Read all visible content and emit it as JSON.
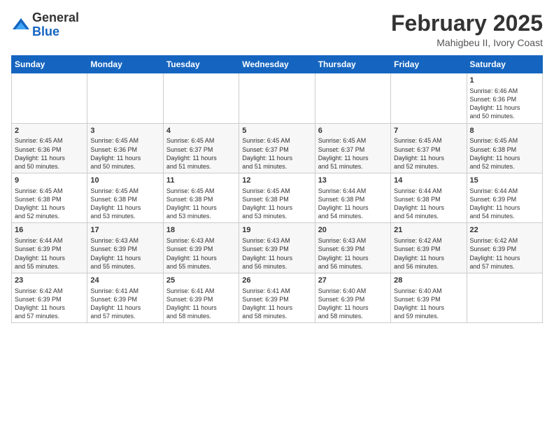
{
  "header": {
    "logo_general": "General",
    "logo_blue": "Blue",
    "month_title": "February 2025",
    "location": "Mahigbeu II, Ivory Coast"
  },
  "weekdays": [
    "Sunday",
    "Monday",
    "Tuesday",
    "Wednesday",
    "Thursday",
    "Friday",
    "Saturday"
  ],
  "weeks": [
    [
      {
        "day": "",
        "info": ""
      },
      {
        "day": "",
        "info": ""
      },
      {
        "day": "",
        "info": ""
      },
      {
        "day": "",
        "info": ""
      },
      {
        "day": "",
        "info": ""
      },
      {
        "day": "",
        "info": ""
      },
      {
        "day": "1",
        "info": "Sunrise: 6:46 AM\nSunset: 6:36 PM\nDaylight: 11 hours\nand 50 minutes."
      }
    ],
    [
      {
        "day": "2",
        "info": "Sunrise: 6:45 AM\nSunset: 6:36 PM\nDaylight: 11 hours\nand 50 minutes."
      },
      {
        "day": "3",
        "info": "Sunrise: 6:45 AM\nSunset: 6:36 PM\nDaylight: 11 hours\nand 50 minutes."
      },
      {
        "day": "4",
        "info": "Sunrise: 6:45 AM\nSunset: 6:37 PM\nDaylight: 11 hours\nand 51 minutes."
      },
      {
        "day": "5",
        "info": "Sunrise: 6:45 AM\nSunset: 6:37 PM\nDaylight: 11 hours\nand 51 minutes."
      },
      {
        "day": "6",
        "info": "Sunrise: 6:45 AM\nSunset: 6:37 PM\nDaylight: 11 hours\nand 51 minutes."
      },
      {
        "day": "7",
        "info": "Sunrise: 6:45 AM\nSunset: 6:37 PM\nDaylight: 11 hours\nand 52 minutes."
      },
      {
        "day": "8",
        "info": "Sunrise: 6:45 AM\nSunset: 6:38 PM\nDaylight: 11 hours\nand 52 minutes."
      }
    ],
    [
      {
        "day": "9",
        "info": "Sunrise: 6:45 AM\nSunset: 6:38 PM\nDaylight: 11 hours\nand 52 minutes."
      },
      {
        "day": "10",
        "info": "Sunrise: 6:45 AM\nSunset: 6:38 PM\nDaylight: 11 hours\nand 53 minutes."
      },
      {
        "day": "11",
        "info": "Sunrise: 6:45 AM\nSunset: 6:38 PM\nDaylight: 11 hours\nand 53 minutes."
      },
      {
        "day": "12",
        "info": "Sunrise: 6:45 AM\nSunset: 6:38 PM\nDaylight: 11 hours\nand 53 minutes."
      },
      {
        "day": "13",
        "info": "Sunrise: 6:44 AM\nSunset: 6:38 PM\nDaylight: 11 hours\nand 54 minutes."
      },
      {
        "day": "14",
        "info": "Sunrise: 6:44 AM\nSunset: 6:38 PM\nDaylight: 11 hours\nand 54 minutes."
      },
      {
        "day": "15",
        "info": "Sunrise: 6:44 AM\nSunset: 6:39 PM\nDaylight: 11 hours\nand 54 minutes."
      }
    ],
    [
      {
        "day": "16",
        "info": "Sunrise: 6:44 AM\nSunset: 6:39 PM\nDaylight: 11 hours\nand 55 minutes."
      },
      {
        "day": "17",
        "info": "Sunrise: 6:43 AM\nSunset: 6:39 PM\nDaylight: 11 hours\nand 55 minutes."
      },
      {
        "day": "18",
        "info": "Sunrise: 6:43 AM\nSunset: 6:39 PM\nDaylight: 11 hours\nand 55 minutes."
      },
      {
        "day": "19",
        "info": "Sunrise: 6:43 AM\nSunset: 6:39 PM\nDaylight: 11 hours\nand 56 minutes."
      },
      {
        "day": "20",
        "info": "Sunrise: 6:43 AM\nSunset: 6:39 PM\nDaylight: 11 hours\nand 56 minutes."
      },
      {
        "day": "21",
        "info": "Sunrise: 6:42 AM\nSunset: 6:39 PM\nDaylight: 11 hours\nand 56 minutes."
      },
      {
        "day": "22",
        "info": "Sunrise: 6:42 AM\nSunset: 6:39 PM\nDaylight: 11 hours\nand 57 minutes."
      }
    ],
    [
      {
        "day": "23",
        "info": "Sunrise: 6:42 AM\nSunset: 6:39 PM\nDaylight: 11 hours\nand 57 minutes."
      },
      {
        "day": "24",
        "info": "Sunrise: 6:41 AM\nSunset: 6:39 PM\nDaylight: 11 hours\nand 57 minutes."
      },
      {
        "day": "25",
        "info": "Sunrise: 6:41 AM\nSunset: 6:39 PM\nDaylight: 11 hours\nand 58 minutes."
      },
      {
        "day": "26",
        "info": "Sunrise: 6:41 AM\nSunset: 6:39 PM\nDaylight: 11 hours\nand 58 minutes."
      },
      {
        "day": "27",
        "info": "Sunrise: 6:40 AM\nSunset: 6:39 PM\nDaylight: 11 hours\nand 58 minutes."
      },
      {
        "day": "28",
        "info": "Sunrise: 6:40 AM\nSunset: 6:39 PM\nDaylight: 11 hours\nand 59 minutes."
      },
      {
        "day": "",
        "info": ""
      }
    ]
  ]
}
